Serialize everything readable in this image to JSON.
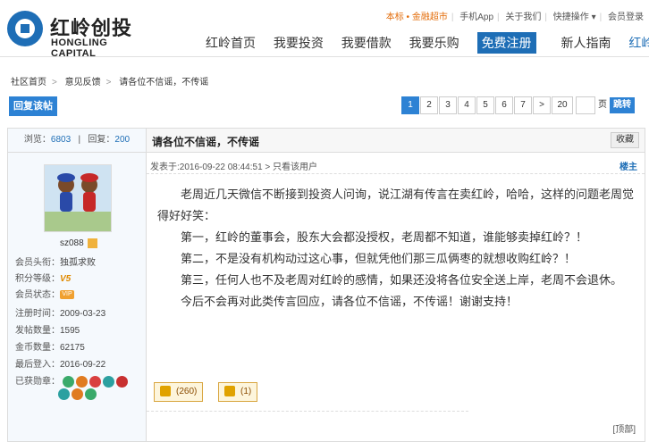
{
  "brand": {
    "name_cn": "红岭创投",
    "name_en": "HONGLING CAPITAL"
  },
  "topbar": {
    "items": [
      "本标 • 金融超市",
      "手机App",
      "关于我们",
      "快捷操作 ▾",
      "会员登录"
    ]
  },
  "nav": {
    "items": [
      "红岭首页",
      "我要投资",
      "我要借款",
      "我要乐购",
      "免费注册",
      "新人指南",
      "红岭社区"
    ]
  },
  "breadcrumb": {
    "items": [
      "社区首页",
      "意见反馈",
      "请各位不信谣，不传谣"
    ]
  },
  "actions": {
    "reply": "回复该帖"
  },
  "pager": {
    "pages": [
      "1",
      "2",
      "3",
      "4",
      "5",
      "6",
      "7",
      ">",
      "20"
    ],
    "unit": "页",
    "go": "跳转"
  },
  "stats": {
    "views_label": "浏览：",
    "views": "6803",
    "replies_label": "回复：",
    "replies": "200"
  },
  "user": {
    "name": "sz088",
    "fields": [
      {
        "label": "会员头衔：",
        "value": "独孤求败"
      },
      {
        "label": "积分等级：",
        "value": "V5"
      },
      {
        "label": "会员状态：",
        "value": "VIP"
      },
      {
        "label": "注册时间：",
        "value": "2009-03-23"
      },
      {
        "label": "发帖数量：",
        "value": "1595"
      },
      {
        "label": "金币数量：",
        "value": "62175"
      },
      {
        "label": "最后登入：",
        "value": "2016-09-22"
      },
      {
        "label": "已获勋章：",
        "value": ""
      }
    ]
  },
  "post": {
    "title": "请各位不信谣，不传谣",
    "collect": "收藏",
    "meta": "发表于:2016-09-22 08:44:51   > 只看该用户",
    "floor": "楼主",
    "paragraphs": [
      "老周近几天微信不断接到投资人问询，说江湖有传言在卖红岭，哈哈，这样的问题老周觉得好好笑：",
      "第一，红岭的董事会，股东大会都没授权，老周都不知道，谁能够卖掉红岭？！",
      "第二，不是没有机构动过这心事，但就凭他们那三瓜俩枣的就想收购红岭？！",
      "第三，任何人也不及老周对红岭的感情，如果还没将各位安全送上岸，老周不会退休。",
      "今后不会再对此类传言回应，请各位不信谣，不传谣！谢谢支持！"
    ],
    "up_votes": "(260)",
    "down_votes": "(1)",
    "report": "[顶部]"
  },
  "colors": {
    "brand_blue": "#1e6eb6",
    "accent_orange": "#e36c09"
  }
}
